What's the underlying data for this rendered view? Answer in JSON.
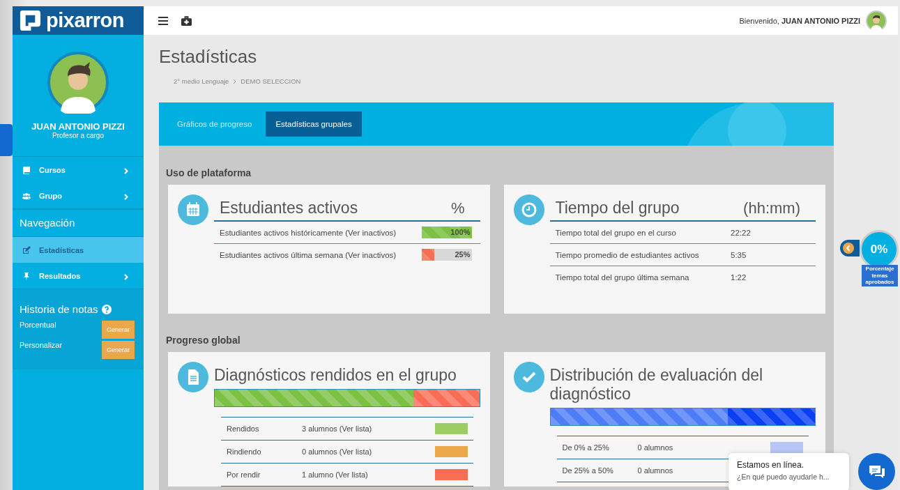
{
  "header": {
    "greeting": "Bienvenido,",
    "user_name": "JUAN ANTONIO PIZZI"
  },
  "sidebar": {
    "logo": "pixarron",
    "profile": {
      "name": "JUAN ANTONIO PIZZI",
      "role": "Profesor a cargo"
    },
    "items": [
      {
        "kind": "link",
        "label": "Cursos",
        "expandable": true,
        "selected": false
      },
      {
        "kind": "link",
        "label": "Grupo",
        "expandable": true,
        "selected": false
      },
      {
        "kind": "heading",
        "label": "Navegación"
      },
      {
        "kind": "link",
        "label": "Estadísticas",
        "expandable": false,
        "selected": true
      },
      {
        "kind": "link",
        "label": "Resultados",
        "expandable": true,
        "selected": false
      }
    ],
    "history": {
      "title": "Historia de notas",
      "rows": [
        {
          "label": "Porcentual",
          "button": "Generar"
        },
        {
          "label": "Personalizar",
          "button": "Generar"
        }
      ]
    }
  },
  "page": {
    "title": "Estadísticas",
    "breadcrumb": [
      "2° medio Lenguaje",
      "DEMO SELECCION"
    ]
  },
  "tabs": [
    {
      "label": "Gráficos de progreso",
      "selected": false
    },
    {
      "label": "Estadísticas grupales",
      "selected": true
    }
  ],
  "sections": [
    {
      "title": "Uso de plataforma",
      "cards": [
        {
          "kind": "bars",
          "title": "Estudiantes activos",
          "unit": "%",
          "rows": [
            {
              "label": "Estudiantes activos históricamente (Ver inactivos)",
              "level": 1,
              "reading": "100%",
              "color": "#7cc142"
            },
            {
              "label": "Estudiantes activos última semana (Ver inactivos)",
              "level": 0.25,
              "reading": "25%",
              "color": "#f76e55"
            }
          ]
        },
        {
          "kind": "table",
          "title": "Tiempo del grupo",
          "unit": "(hh:mm)",
          "rows": [
            {
              "label": "Tiempo total del grupo en el curso",
              "value": "22:22"
            },
            {
              "label": "Tiempo promedio de estudiantes activos",
              "value": "5:35"
            },
            {
              "label": "Tiempo total del grupo última semana",
              "value": "1:22"
            }
          ]
        }
      ]
    },
    {
      "title": "Progreso global",
      "cards": [
        {
          "kind": "legend",
          "title": "Diagnósticos rendidos en el grupo",
          "segments": [
            {
              "level": 0.75,
              "color": "#7cc142"
            },
            {
              "level": 0.25,
              "color": "#f76e55"
            }
          ],
          "rows": [
            {
              "label": "Rendidos",
              "value": "3 alumnos (Ver lista)",
              "color": "#9ccc65"
            },
            {
              "label": "Rindiendo",
              "value": "0 alumnos (Ver lista)",
              "color": "#eaa84b"
            },
            {
              "label": "Por rendir",
              "value": "1 alumno (Ver lista)",
              "color": "#f76e55"
            }
          ]
        },
        {
          "kind": "legend",
          "title": "Distribución de evaluación del diagnóstico",
          "segments": [
            {
              "level": 0.67,
              "color": "#4d7df6"
            },
            {
              "level": 0.33,
              "color": "#0b3ff2"
            }
          ],
          "rows": [
            {
              "label": "De 0% a 25%",
              "value": "0 alumnos",
              "color": "#b7c6f6"
            },
            {
              "label": "De 25% a 50%",
              "value": "0 alumnos"
            }
          ]
        }
      ]
    }
  ],
  "progress_widget": {
    "value": "0%",
    "label": "Porcentaje temas aprobados"
  },
  "chat": {
    "title": "Estamos en línea.",
    "message": "¿En qué puedo ayudarle h..."
  }
}
